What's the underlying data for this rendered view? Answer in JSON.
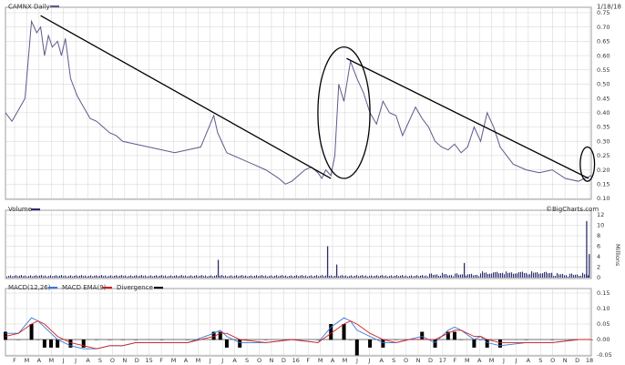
{
  "header": {
    "title": "CAMNX Daily",
    "date": "1/18/18"
  },
  "colors": {
    "price": "#5c5a8c",
    "volume": "#2c2c6e",
    "macd": "#3a78d8",
    "ema": "#d02020",
    "divergence": "#000000",
    "grid": "#c8c8c8",
    "annotation": "#000000"
  },
  "chart_data": [
    {
      "type": "line",
      "name": "price",
      "title": "CAMNX Daily",
      "date_label": "1/18/18",
      "yticks": [
        "0.75",
        "0.70",
        "0.65",
        "0.60",
        "0.55",
        "0.50",
        "0.45",
        "0.40",
        "0.35",
        "0.30",
        "0.25",
        "0.20",
        "0.15",
        "0.10"
      ],
      "ylim": [
        0.1,
        0.75
      ],
      "xlim": [
        0,
        45
      ],
      "x": [
        0,
        0.5,
        1,
        1.5,
        2,
        2.4,
        2.7,
        3,
        3.3,
        3.6,
        4,
        4.3,
        4.6,
        5,
        5.5,
        6,
        6.5,
        7,
        7.5,
        8,
        8.5,
        9,
        10,
        11,
        12,
        13,
        14,
        15,
        16,
        16.3,
        16.6,
        17,
        18,
        19,
        20,
        21,
        21.5,
        22,
        22.5,
        23,
        23.5,
        24,
        24.3,
        24.6,
        25,
        25.3,
        25.6,
        26,
        26.5,
        27,
        27.5,
        28,
        28.5,
        29,
        29.5,
        30,
        30.5,
        31,
        31.5,
        32,
        32.5,
        33,
        33.5,
        34,
        34.5,
        35,
        35.5,
        36,
        36.5,
        37,
        37.5,
        38,
        38.5,
        39,
        40,
        41,
        42,
        43,
        44,
        44.5,
        45
      ],
      "values": [
        0.4,
        0.37,
        0.41,
        0.45,
        0.72,
        0.68,
        0.7,
        0.6,
        0.67,
        0.63,
        0.65,
        0.6,
        0.66,
        0.52,
        0.46,
        0.42,
        0.38,
        0.37,
        0.35,
        0.33,
        0.32,
        0.3,
        0.29,
        0.28,
        0.27,
        0.26,
        0.27,
        0.28,
        0.39,
        0.33,
        0.3,
        0.26,
        0.24,
        0.22,
        0.2,
        0.17,
        0.15,
        0.16,
        0.18,
        0.2,
        0.21,
        0.19,
        0.17,
        0.2,
        0.18,
        0.25,
        0.5,
        0.44,
        0.58,
        0.52,
        0.47,
        0.4,
        0.36,
        0.44,
        0.4,
        0.39,
        0.32,
        0.37,
        0.42,
        0.38,
        0.35,
        0.3,
        0.28,
        0.27,
        0.29,
        0.26,
        0.28,
        0.35,
        0.3,
        0.4,
        0.35,
        0.28,
        0.25,
        0.22,
        0.2,
        0.19,
        0.2,
        0.17,
        0.16,
        0.17,
        0.18
      ],
      "trendlines": [
        {
          "x1": 2.7,
          "y1": 0.74,
          "x2": 25.0,
          "y2": 0.17
        },
        {
          "x1": 26.2,
          "y1": 0.59,
          "x2": 44.8,
          "y2": 0.17
        }
      ],
      "ellipses": [
        {
          "cx": 26.0,
          "cy": 0.4,
          "rx": 2.0,
          "ry": 0.23
        },
        {
          "cx": 44.7,
          "cy": 0.22,
          "rx": 0.55,
          "ry": 0.06
        }
      ]
    },
    {
      "type": "bar",
      "name": "volume",
      "title": "Volume",
      "yticks": [
        "12",
        "10",
        "8",
        "6",
        "4",
        "2",
        "0"
      ],
      "ylim": [
        0,
        12
      ],
      "ylabel": "Millions",
      "watermark": "©BigCharts.com",
      "xlim": [
        0,
        45
      ],
      "spikes": [
        {
          "x": 16.3,
          "value": 3.4
        },
        {
          "x": 24.7,
          "value": 6.0
        },
        {
          "x": 25.4,
          "value": 2.5
        },
        {
          "x": 35.2,
          "value": 2.8
        },
        {
          "x": 44.6,
          "value": 10.8
        },
        {
          "x": 44.8,
          "value": 4.5
        }
      ]
    },
    {
      "type": "line",
      "name": "macd",
      "title": "MACD(12,26)",
      "legend": [
        "MACD EMA(9)",
        "Divergence"
      ],
      "yticks": [
        "0.15",
        "0.10",
        "0.05",
        "0.00",
        "-0.05"
      ],
      "ylim": [
        -0.05,
        0.15
      ],
      "xlim": [
        0,
        45
      ],
      "x": [
        0,
        1,
        2,
        2.5,
        3,
        3.5,
        4,
        5,
        6,
        7,
        8,
        9,
        10,
        12,
        14,
        16,
        16.5,
        17,
        18,
        20,
        22,
        24,
        25,
        26,
        26.5,
        27,
        28,
        29,
        30,
        31,
        32,
        33,
        34,
        34.5,
        35,
        36,
        36.5,
        37,
        38,
        40,
        42,
        44,
        45
      ],
      "values": [
        0.02,
        0.02,
        0.07,
        0.06,
        0.04,
        0.02,
        0.0,
        -0.02,
        -0.03,
        -0.03,
        -0.02,
        -0.02,
        -0.01,
        -0.01,
        -0.01,
        0.02,
        0.03,
        0.01,
        -0.01,
        -0.01,
        0.0,
        -0.01,
        0.04,
        0.07,
        0.06,
        0.03,
        0.01,
        -0.01,
        -0.01,
        0.0,
        0.01,
        -0.01,
        0.03,
        0.04,
        0.03,
        0.0,
        0.01,
        -0.01,
        -0.02,
        -0.01,
        -0.01,
        0.0,
        0.0
      ],
      "ema_values": [
        0.01,
        0.02,
        0.05,
        0.06,
        0.05,
        0.03,
        0.01,
        -0.01,
        -0.02,
        -0.03,
        -0.02,
        -0.02,
        -0.01,
        -0.01,
        -0.01,
        0.01,
        0.02,
        0.02,
        0.0,
        -0.01,
        0.0,
        -0.01,
        0.02,
        0.05,
        0.06,
        0.05,
        0.02,
        0.0,
        -0.01,
        0.0,
        0.0,
        0.0,
        0.02,
        0.03,
        0.03,
        0.01,
        0.01,
        0.0,
        -0.01,
        -0.01,
        -0.01,
        0.0,
        0.0
      ],
      "xticks": [
        "F",
        "M",
        "A",
        "M",
        "J",
        "J",
        "A",
        "S",
        "O",
        "N",
        "D",
        "15",
        "F",
        "M",
        "A",
        "M",
        "J",
        "J",
        "A",
        "S",
        "O",
        "N",
        "D",
        "16",
        "F",
        "M",
        "A",
        "M",
        "J",
        "J",
        "A",
        "S",
        "O",
        "N",
        "D",
        "17",
        "F",
        "M",
        "A",
        "M",
        "J",
        "J",
        "A",
        "S",
        "O",
        "N",
        "D",
        "18"
      ]
    }
  ]
}
